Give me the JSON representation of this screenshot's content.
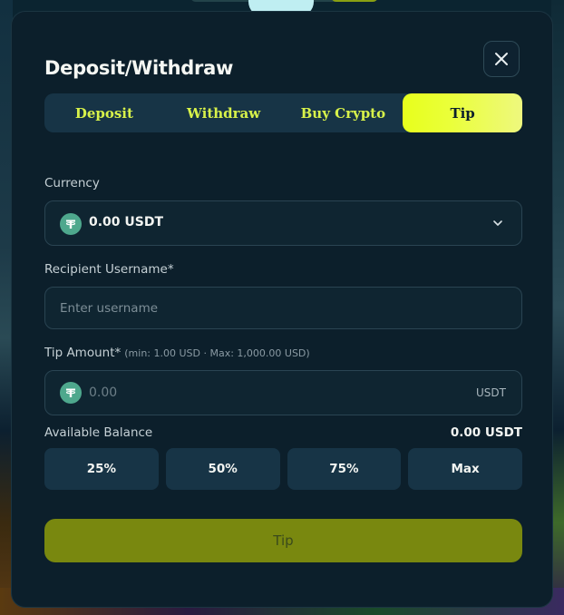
{
  "modal": {
    "title": "Deposit/Withdraw",
    "tabs": [
      {
        "label": "Deposit",
        "active": false
      },
      {
        "label": "Withdraw",
        "active": false
      },
      {
        "label": "Buy Crypto",
        "active": false
      },
      {
        "label": "Tip",
        "active": true
      }
    ]
  },
  "currency": {
    "label": "Currency",
    "selected": "0.00 USDT",
    "icon": "tether-icon"
  },
  "recipient": {
    "label": "Recipient Username*",
    "placeholder": "Enter username",
    "value": ""
  },
  "tip_amount": {
    "label": "Tip Amount*",
    "hint": "(min: 1.00 USD · Max: 1,000.00 USD)",
    "placeholder": "0.00",
    "unit": "USDT",
    "value": ""
  },
  "balance": {
    "label": "Available Balance",
    "amount": "0.00",
    "currency": "USDT"
  },
  "percent_buttons": [
    "25%",
    "50%",
    "75%",
    "Max"
  ],
  "submit": {
    "label": "Tip"
  },
  "colors": {
    "accent": "#e7ff1c",
    "modal_bg": "#0c1f2b",
    "submit_bg": "#79880f"
  }
}
